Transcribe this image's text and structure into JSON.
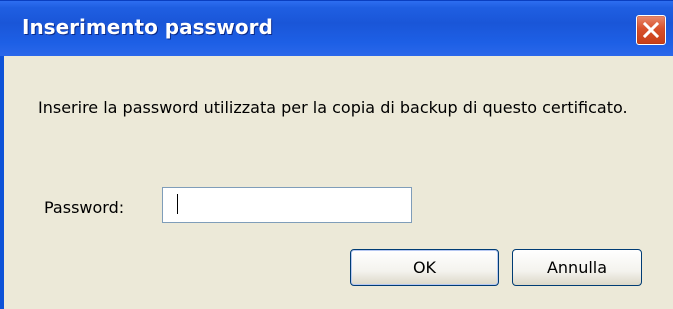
{
  "window": {
    "title": "Inserimento password"
  },
  "message": "Inserire la password utilizzata per la copia di backup di questo certificato.",
  "password": {
    "label": "Password:",
    "value": ""
  },
  "buttons": {
    "ok_label": "OK",
    "cancel_label": "Annulla"
  },
  "colors": {
    "titlebar": "#1f5fe2",
    "dialog_background": "#ece9d8",
    "close_button": "#d8512c",
    "button_border": "#003c74"
  },
  "icons": {
    "close": "close-icon"
  }
}
